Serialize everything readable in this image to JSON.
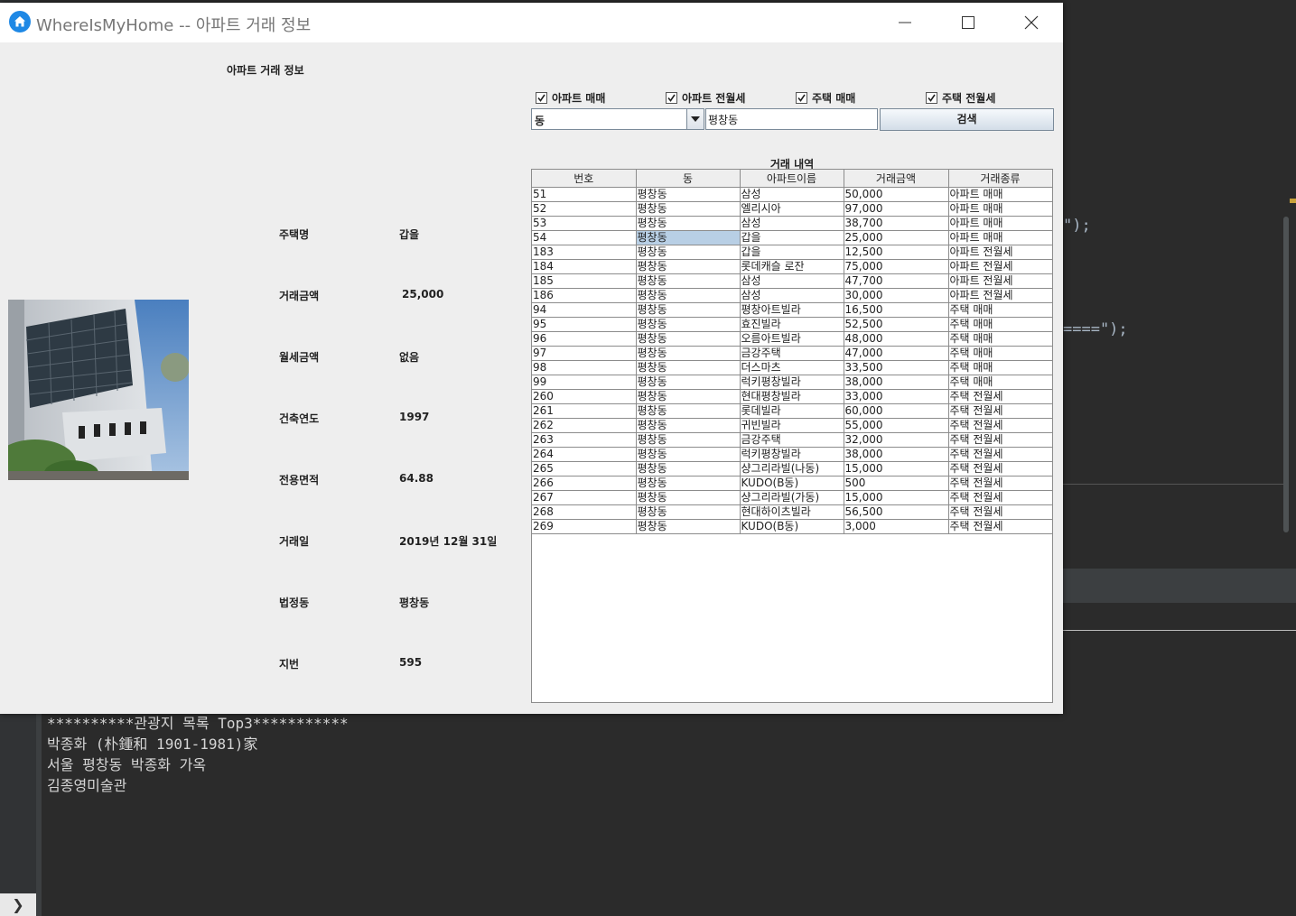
{
  "window": {
    "title": "WhereIsMyHome -- 아파트 거래 정보"
  },
  "panel_title": "아파트 거래 정보",
  "details": [
    {
      "label": "주택명",
      "value": "갑을"
    },
    {
      "label": "거래금액",
      "value": "25,000"
    },
    {
      "label": "월세금액",
      "value": "없음"
    },
    {
      "label": "건축연도",
      "value": "1997"
    },
    {
      "label": "전용면적",
      "value": "64.88"
    },
    {
      "label": "거래일",
      "value": "2019년 12월 31일"
    },
    {
      "label": "법정동",
      "value": "평창동"
    },
    {
      "label": "지번",
      "value": "595"
    }
  ],
  "filters": [
    {
      "label": "아파트 매매",
      "checked": true
    },
    {
      "label": "아파트 전월세",
      "checked": true
    },
    {
      "label": "주택 매매",
      "checked": true
    },
    {
      "label": "주택 전월세",
      "checked": true
    }
  ],
  "search": {
    "combo_value": "동",
    "input_value": "평창동",
    "button_label": "검색"
  },
  "table": {
    "title": "거래 내역",
    "columns": [
      "번호",
      "동",
      "아파트이름",
      "거래금액",
      "거래종류"
    ],
    "rows": [
      [
        "51",
        "평창동",
        "삼성",
        "50,000",
        "아파트 매매"
      ],
      [
        "52",
        "평창동",
        "엘리시아",
        "97,000",
        "아파트 매매"
      ],
      [
        "53",
        "평창동",
        "삼성",
        "38,700",
        "아파트 매매"
      ],
      [
        "54",
        "평창동",
        "갑을",
        "25,000",
        "아파트 매매"
      ],
      [
        "183",
        "평창동",
        "갑을",
        "12,500",
        "아파트 전월세"
      ],
      [
        "184",
        "평창동",
        "롯데캐슬 로잔",
        "75,000",
        "아파트 전월세"
      ],
      [
        "185",
        "평창동",
        "삼성",
        "47,700",
        "아파트 전월세"
      ],
      [
        "186",
        "평창동",
        "삼성",
        "30,000",
        "아파트 전월세"
      ],
      [
        "94",
        "평창동",
        "평창아트빌라",
        "16,500",
        "주택 매매"
      ],
      [
        "95",
        "평창동",
        "효진빌라",
        "52,500",
        "주택 매매"
      ],
      [
        "96",
        "평창동",
        "오름아트빌라",
        "48,000",
        "주택 매매"
      ],
      [
        "97",
        "평창동",
        "금강주택",
        "47,000",
        "주택 매매"
      ],
      [
        "98",
        "평창동",
        "더스마츠",
        "33,500",
        "주택 매매"
      ],
      [
        "99",
        "평창동",
        "럭키평창빌라",
        "38,000",
        "주택 매매"
      ],
      [
        "260",
        "평창동",
        "현대평창빌라",
        "33,000",
        "주택 전월세"
      ],
      [
        "261",
        "평창동",
        "롯데빌라",
        "60,000",
        "주택 전월세"
      ],
      [
        "262",
        "평창동",
        "귀빈빌라",
        "55,000",
        "주택 전월세"
      ],
      [
        "263",
        "평창동",
        "금강주택",
        "32,000",
        "주택 전월세"
      ],
      [
        "264",
        "평창동",
        "럭키평창빌라",
        "38,000",
        "주택 전월세"
      ],
      [
        "265",
        "평창동",
        "샹그리라빌(나동)",
        "15,000",
        "주택 전월세"
      ],
      [
        "266",
        "평창동",
        "KUDO(B동)",
        "500",
        "주택 전월세"
      ],
      [
        "267",
        "평창동",
        "샹그리라빌(가동)",
        "15,000",
        "주택 전월세"
      ],
      [
        "268",
        "평창동",
        "현대하이츠빌라",
        "56,500",
        "주택 전월세"
      ],
      [
        "269",
        "평창동",
        "KUDO(B동)",
        "3,000",
        "주택 전월세"
      ]
    ],
    "selected_row": 3,
    "selected_col": 1
  },
  "ide": {
    "code_line_1": "\");",
    "code_line_2": "====\");",
    "console_lines": [
      "**********관광지 목록 Top3***********",
      "박종화 (朴鍾和 1901-1981)家",
      "서울 평창동 박종화 가옥",
      "김종영미술관"
    ],
    "toggle_label": "❯"
  }
}
